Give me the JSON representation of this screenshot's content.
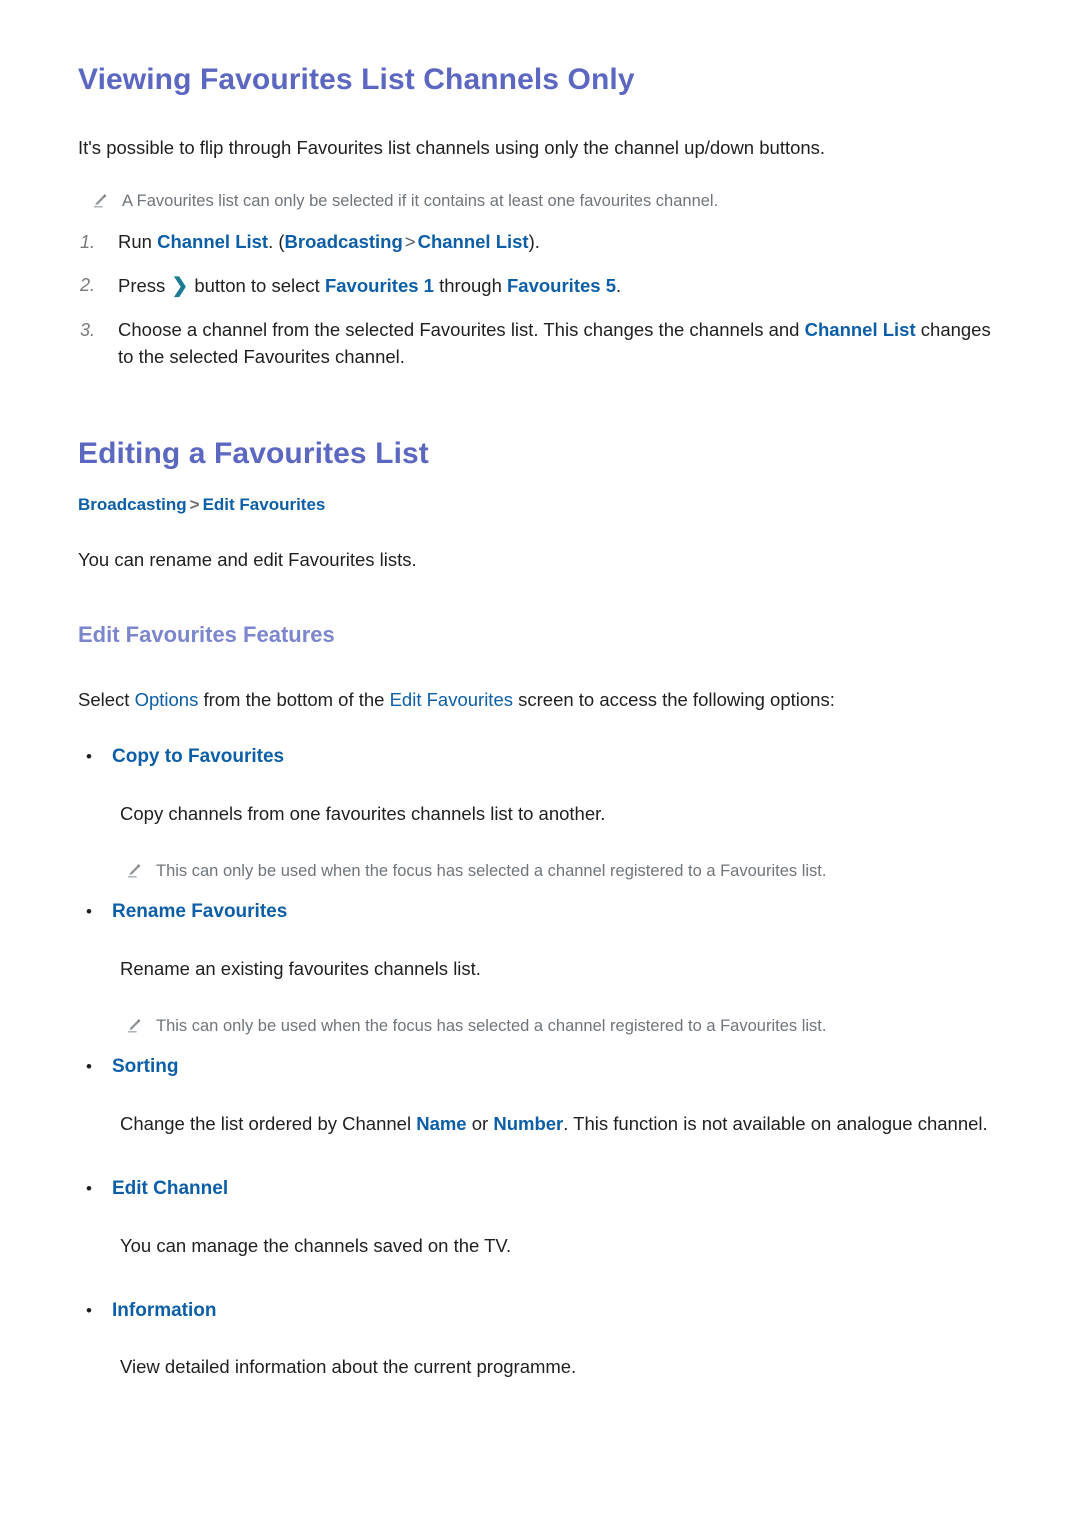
{
  "section1": {
    "heading": "Viewing Favourites List Channels Only",
    "intro": "It's possible to flip through Favourites list channels using only the channel up/down buttons.",
    "note": "A Favourites list can only be selected if it contains at least one favourites channel.",
    "steps": [
      {
        "num": "1.",
        "parts": [
          {
            "text": "Run ",
            "style": "plain"
          },
          {
            "text": "Channel List",
            "style": "blue"
          },
          {
            "text": ". (",
            "style": "plain"
          },
          {
            "text": "Broadcasting",
            "style": "blue"
          },
          {
            "text": ">",
            "style": "gt"
          },
          {
            "text": "Channel List",
            "style": "blue"
          },
          {
            "text": ").",
            "style": "plain"
          }
        ]
      },
      {
        "num": "2.",
        "parts": [
          {
            "text": "Press ",
            "style": "plain"
          },
          {
            "text": "❯",
            "style": "arrow"
          },
          {
            "text": " button to select ",
            "style": "plain"
          },
          {
            "text": "Favourites 1",
            "style": "blue"
          },
          {
            "text": " through ",
            "style": "plain"
          },
          {
            "text": "Favourites 5",
            "style": "blue"
          },
          {
            "text": ".",
            "style": "plain"
          }
        ]
      },
      {
        "num": "3.",
        "parts": [
          {
            "text": "Choose a channel from the selected Favourites list. This changes the channels and ",
            "style": "plain"
          },
          {
            "text": "Channel List",
            "style": "blue"
          },
          {
            "text": " changes to the selected Favourites channel.",
            "style": "plain"
          }
        ]
      }
    ]
  },
  "section2": {
    "heading": "Editing a Favourites List",
    "breadcrumb": {
      "first": "Broadcasting",
      "separator": ">",
      "second": "Edit Favourites"
    },
    "intro": "You can rename and edit Favourites lists.",
    "subheading": "Edit Favourites Features",
    "lead": {
      "parts": [
        {
          "text": "Select ",
          "style": "plain"
        },
        {
          "text": "Options",
          "style": "blue-plain"
        },
        {
          "text": " from the bottom of the ",
          "style": "plain"
        },
        {
          "text": "Edit Favourites",
          "style": "blue-plain"
        },
        {
          "text": " screen to access the following options:",
          "style": "plain"
        }
      ]
    },
    "options": [
      {
        "label": "Copy to Favourites",
        "desc_parts": [
          {
            "text": "Copy channels from one favourites channels list to another.",
            "style": "plain"
          }
        ],
        "note": "This can only be used when the focus has selected a channel registered to a Favourites list."
      },
      {
        "label": "Rename Favourites",
        "desc_parts": [
          {
            "text": "Rename an existing favourites channels list.",
            "style": "plain"
          }
        ],
        "note": "This can only be used when the focus has selected a channel registered to a Favourites list."
      },
      {
        "label": "Sorting",
        "desc_parts": [
          {
            "text": "Change the list ordered by Channel ",
            "style": "plain"
          },
          {
            "text": "Name",
            "style": "blue"
          },
          {
            "text": " or ",
            "style": "plain"
          },
          {
            "text": "Number",
            "style": "blue"
          },
          {
            "text": ". This function is not available on analogue channel.",
            "style": "plain"
          }
        ],
        "note": ""
      },
      {
        "label": "Edit Channel",
        "desc_parts": [
          {
            "text": "You can manage the channels saved on the TV.",
            "style": "plain"
          }
        ],
        "note": ""
      },
      {
        "label": "Information",
        "desc_parts": [
          {
            "text": "View detailed information about the current programme.",
            "style": "plain"
          }
        ],
        "note": ""
      }
    ]
  },
  "bullet_glyph": "•",
  "colors": {
    "heading": "#5b67c0",
    "subheading": "#7c86cc",
    "link": "#0c5ea6",
    "note_text": "#6f757a",
    "arrow": "#1c7a94",
    "body": "#1f1f1f"
  }
}
